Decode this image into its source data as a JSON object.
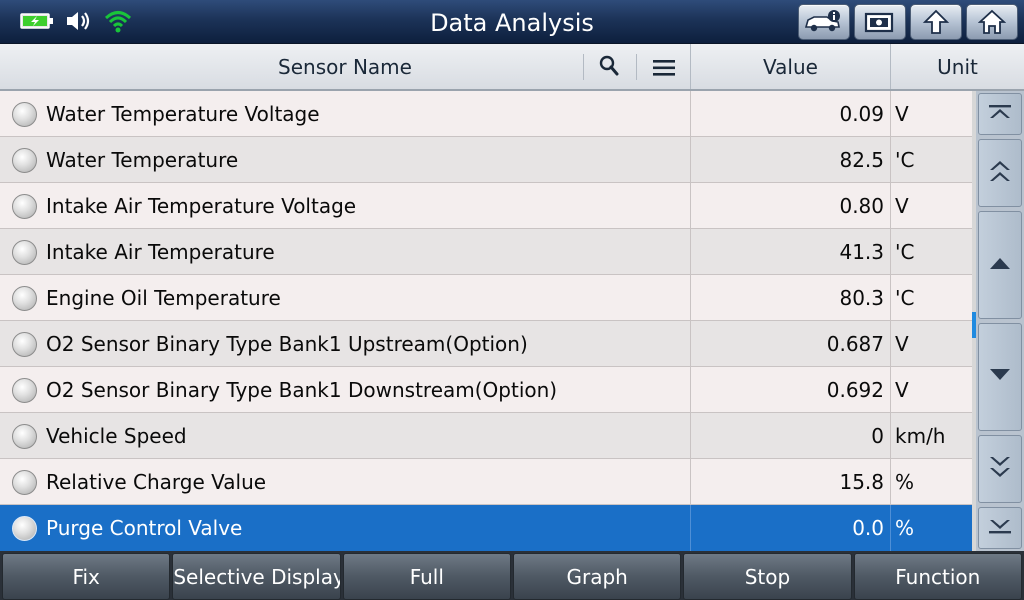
{
  "header": {
    "title": "Data Analysis",
    "colors": {
      "accent_selected_row": "#1a6fc7",
      "wifi": "#19c43a",
      "battery": "#3ecf2e"
    },
    "status_icons": [
      "battery-charging-icon",
      "volume-icon",
      "wifi-icon"
    ],
    "buttons": [
      {
        "icon": "vehicle-info-icon"
      },
      {
        "icon": "screenshot-icon"
      },
      {
        "icon": "back-icon"
      },
      {
        "icon": "home-icon"
      }
    ]
  },
  "table": {
    "columns": {
      "name": "Sensor Name",
      "value": "Value",
      "unit": "Unit"
    },
    "rows": [
      {
        "name": "Water Temperature Voltage",
        "value": "0.09",
        "unit": "V"
      },
      {
        "name": "Water Temperature",
        "value": "82.5",
        "unit": "'C"
      },
      {
        "name": "Intake Air Temperature Voltage",
        "value": "0.80",
        "unit": "V"
      },
      {
        "name": "Intake Air Temperature",
        "value": "41.3",
        "unit": "'C"
      },
      {
        "name": "Engine Oil Temperature",
        "value": "80.3",
        "unit": "'C"
      },
      {
        "name": "O2 Sensor Binary Type Bank1 Upstream(Option)",
        "value": "0.687",
        "unit": "V"
      },
      {
        "name": "O2 Sensor Binary Type Bank1 Downstream(Option)",
        "value": "0.692",
        "unit": "V"
      },
      {
        "name": "Vehicle Speed",
        "value": "0",
        "unit": "km/h"
      },
      {
        "name": "Relative Charge Value",
        "value": "15.8",
        "unit": "%"
      },
      {
        "name": "Purge Control Valve",
        "value": "0.0",
        "unit": "%",
        "selected": true
      }
    ]
  },
  "nav": [
    "scroll-top-icon",
    "page-up-icon",
    "line-up-icon",
    "line-down-icon",
    "page-down-icon",
    "scroll-bottom-icon"
  ],
  "footer": {
    "buttons": [
      "Fix",
      "Selective Display",
      "Full",
      "Graph",
      "Stop",
      "Function"
    ]
  }
}
